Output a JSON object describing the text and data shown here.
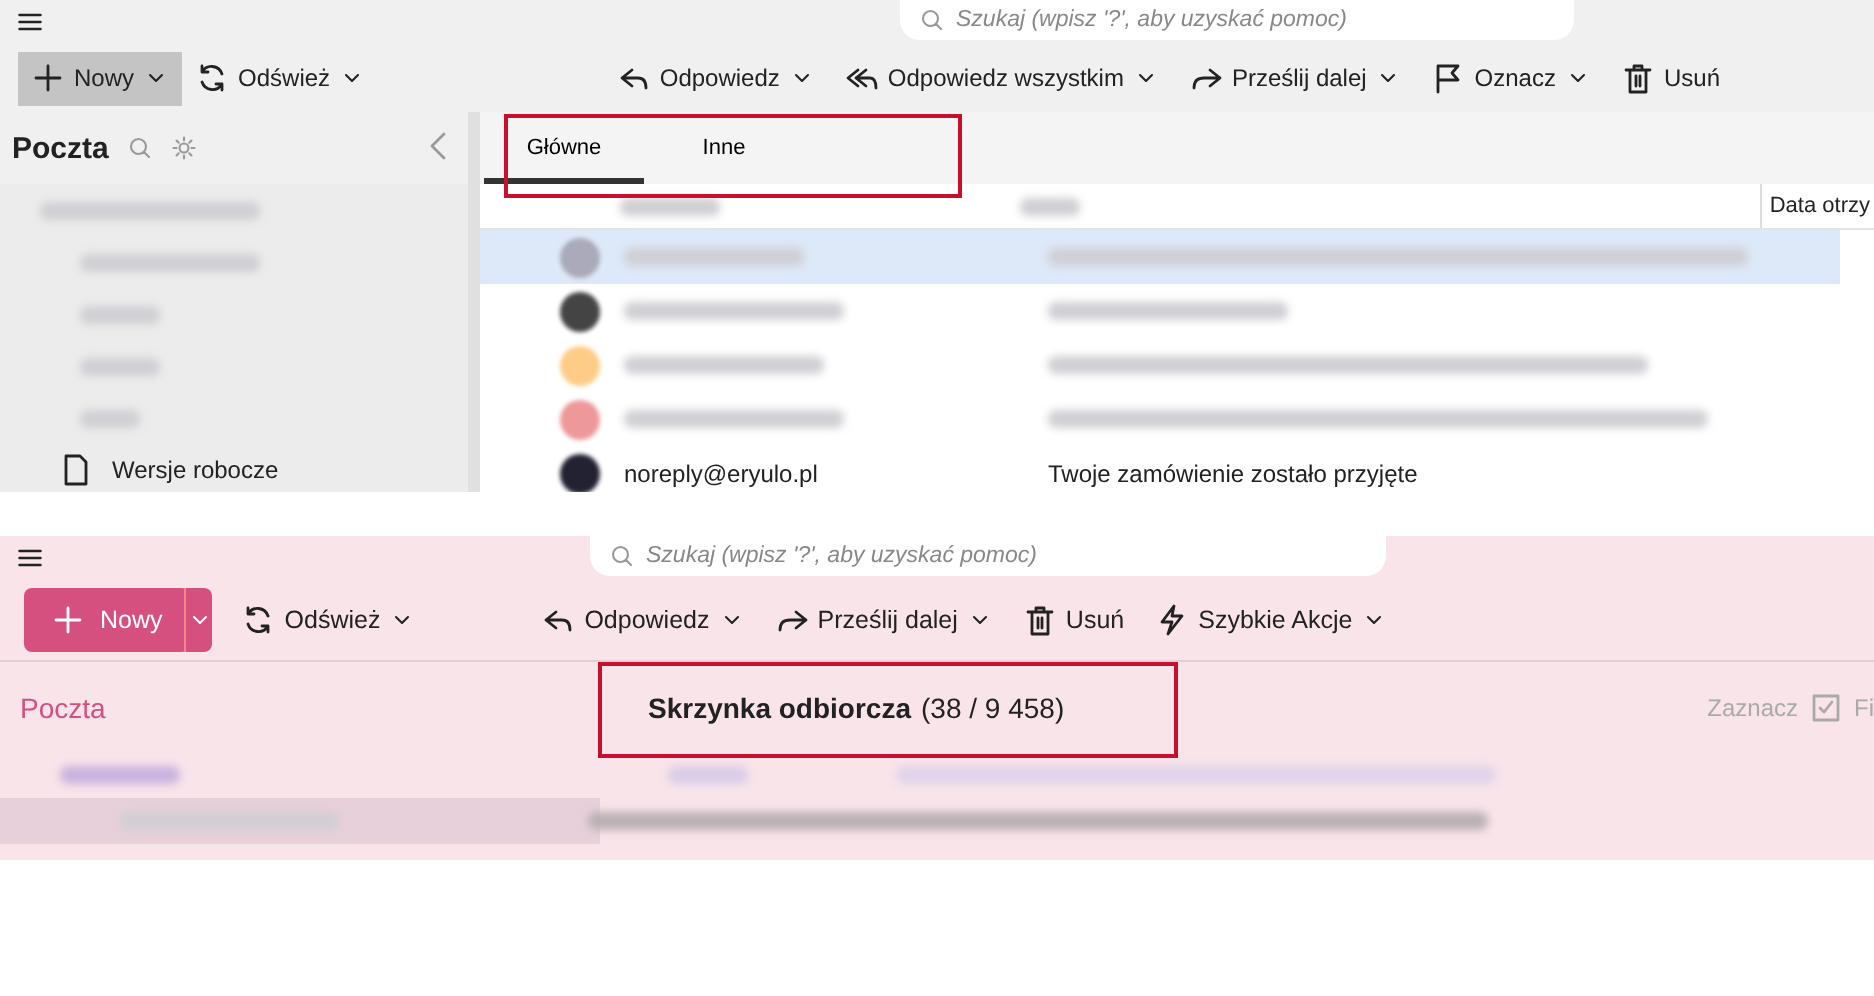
{
  "top_window": {
    "search": {
      "placeholder": "Szukaj (wpisz '?', aby uzyskać pomoc)"
    },
    "new_button": "Nowy",
    "refresh_button": "Odśwież",
    "actions": [
      {
        "kind": "reply",
        "label": "Odpowiedz",
        "has_menu": true
      },
      {
        "kind": "reply-all",
        "label": "Odpowiedz wszystkim",
        "has_menu": true
      },
      {
        "kind": "forward",
        "label": "Prześlij dalej",
        "has_menu": true
      },
      {
        "kind": "flag",
        "label": "Oznacz",
        "has_menu": true
      },
      {
        "kind": "trash",
        "label": "Usuń",
        "has_menu": false
      }
    ],
    "sidebar": {
      "title": "Poczta",
      "folder": "Wersje robocze"
    },
    "tabs": [
      {
        "label": "Główne",
        "selected": true
      },
      {
        "label": "Inne",
        "selected": false
      }
    ],
    "column_header": "Data otrzy",
    "last_row": {
      "sender": "noreply@eryulo.pl",
      "subject": "Twoje zamówienie zostało przyjęte"
    }
  },
  "bottom_window": {
    "search": {
      "placeholder": "Szukaj (wpisz '?', aby uzyskać pomoc)"
    },
    "new_button": "Nowy",
    "refresh_button": "Odśwież",
    "actions": [
      {
        "kind": "reply",
        "label": "Odpowiedz",
        "has_menu": true
      },
      {
        "kind": "forward",
        "label": "Prześlij dalej",
        "has_menu": true
      },
      {
        "kind": "trash",
        "label": "Usuń",
        "has_menu": false
      },
      {
        "kind": "bolt",
        "label": "Szybkie Akcje",
        "has_menu": true
      }
    ],
    "sidebar": {
      "title": "Poczta"
    },
    "folder_title": "Skrzynka odbiorcza",
    "folder_count": "(38 / 9 458)",
    "select_label": "Zaznacz",
    "cut_label": "Fi"
  }
}
